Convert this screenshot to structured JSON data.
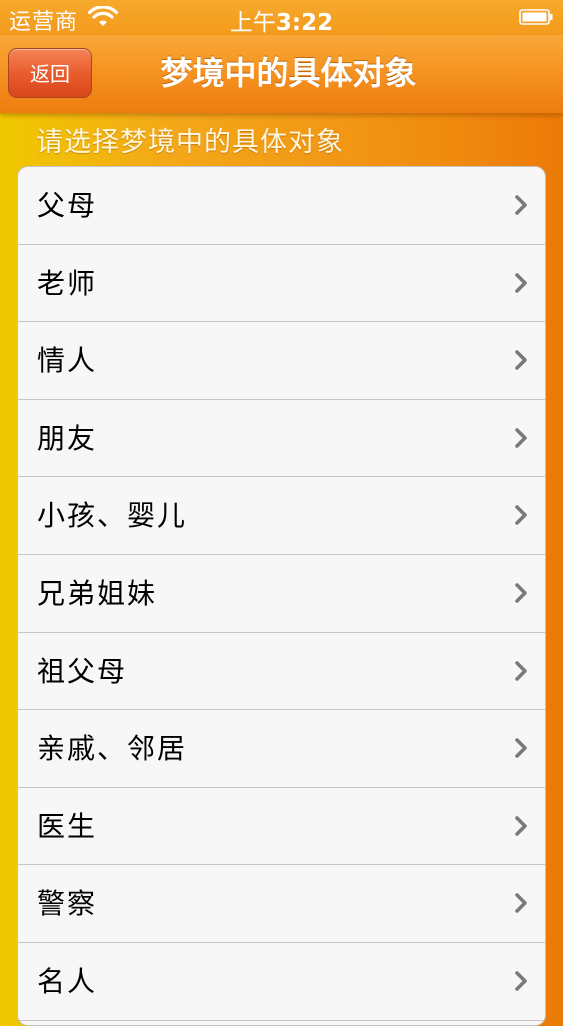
{
  "status_bar": {
    "carrier": "运营商",
    "time_prefix": "上午",
    "time": "3:22"
  },
  "nav": {
    "back_label": "返回",
    "title": "梦境中的具体对象"
  },
  "section": {
    "header": "请选择梦境中的具体对象"
  },
  "items": [
    {
      "label": "父母"
    },
    {
      "label": "老师"
    },
    {
      "label": "情人"
    },
    {
      "label": "朋友"
    },
    {
      "label": "小孩、婴儿"
    },
    {
      "label": "兄弟姐妹"
    },
    {
      "label": "祖父母"
    },
    {
      "label": "亲戚、邻居"
    },
    {
      "label": "医生"
    },
    {
      "label": "警察"
    },
    {
      "label": "名人"
    }
  ],
  "colors": {
    "accent": "#f39a1c",
    "back_button": "#e85a2c",
    "list_background": "#f7f7f7",
    "chevron": "#7a7a7a"
  },
  "icons": {
    "wifi": "wifi-icon",
    "battery": "battery-icon",
    "chevron": "chevron-right-icon"
  }
}
